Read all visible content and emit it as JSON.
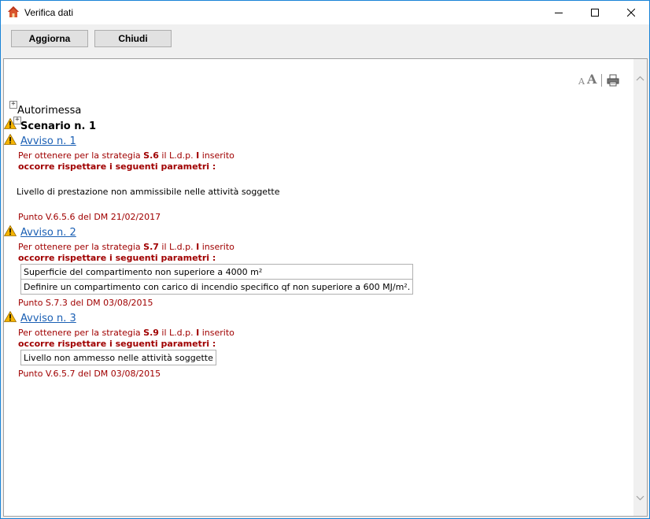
{
  "window": {
    "title": "Verifica dati"
  },
  "toolbar": {
    "refresh_label": "Aggiorna",
    "close_label": "Chiudi"
  },
  "font_tools": {
    "small_a": "A",
    "large_a": "A"
  },
  "tree": {
    "root_label": "Autorimessa",
    "scenario_label": "Scenario n. 1"
  },
  "warnings": [
    {
      "title": "Avviso n. 1",
      "intro_pre": "Per ottenere per la strategia ",
      "strategy": "S.6",
      "intro_mid": " il L.d.p. ",
      "ldp": "I",
      "intro_post": " inserito",
      "params_heading": "occorre rispettare i seguenti parametri :",
      "message": "Livello di prestazione non ammissibile nelle attività soggette",
      "reference": "Punto V.6.5.6 del DM 21/02/2017"
    },
    {
      "title": "Avviso n. 2",
      "intro_pre": "Per ottenere per la strategia ",
      "strategy": "S.7",
      "intro_mid": " il L.d.p. ",
      "ldp": "I",
      "intro_post": " inserito",
      "params_heading": "occorre rispettare i seguenti parametri :",
      "params": [
        "Superficie del compartimento non superiore a 4000 m²",
        "Definire un compartimento con carico di incendio specifico qf non superiore a 600 MJ/m²."
      ],
      "reference": "Punto S.7.3 del DM 03/08/2015"
    },
    {
      "title": "Avviso n. 3",
      "intro_pre": "Per ottenere per la strategia ",
      "strategy": "S.9",
      "intro_mid": " il L.d.p. ",
      "ldp": "I",
      "intro_post": " inserito",
      "params_heading": "occorre rispettare i seguenti parametri :",
      "params": [
        "Livello non ammesso nelle attività soggette"
      ],
      "reference": "Punto V.6.5.7 del DM 03/08/2015"
    }
  ],
  "colors": {
    "warning_text": "#a00000",
    "link": "#1a5fb4",
    "window_border": "#1883d7"
  }
}
